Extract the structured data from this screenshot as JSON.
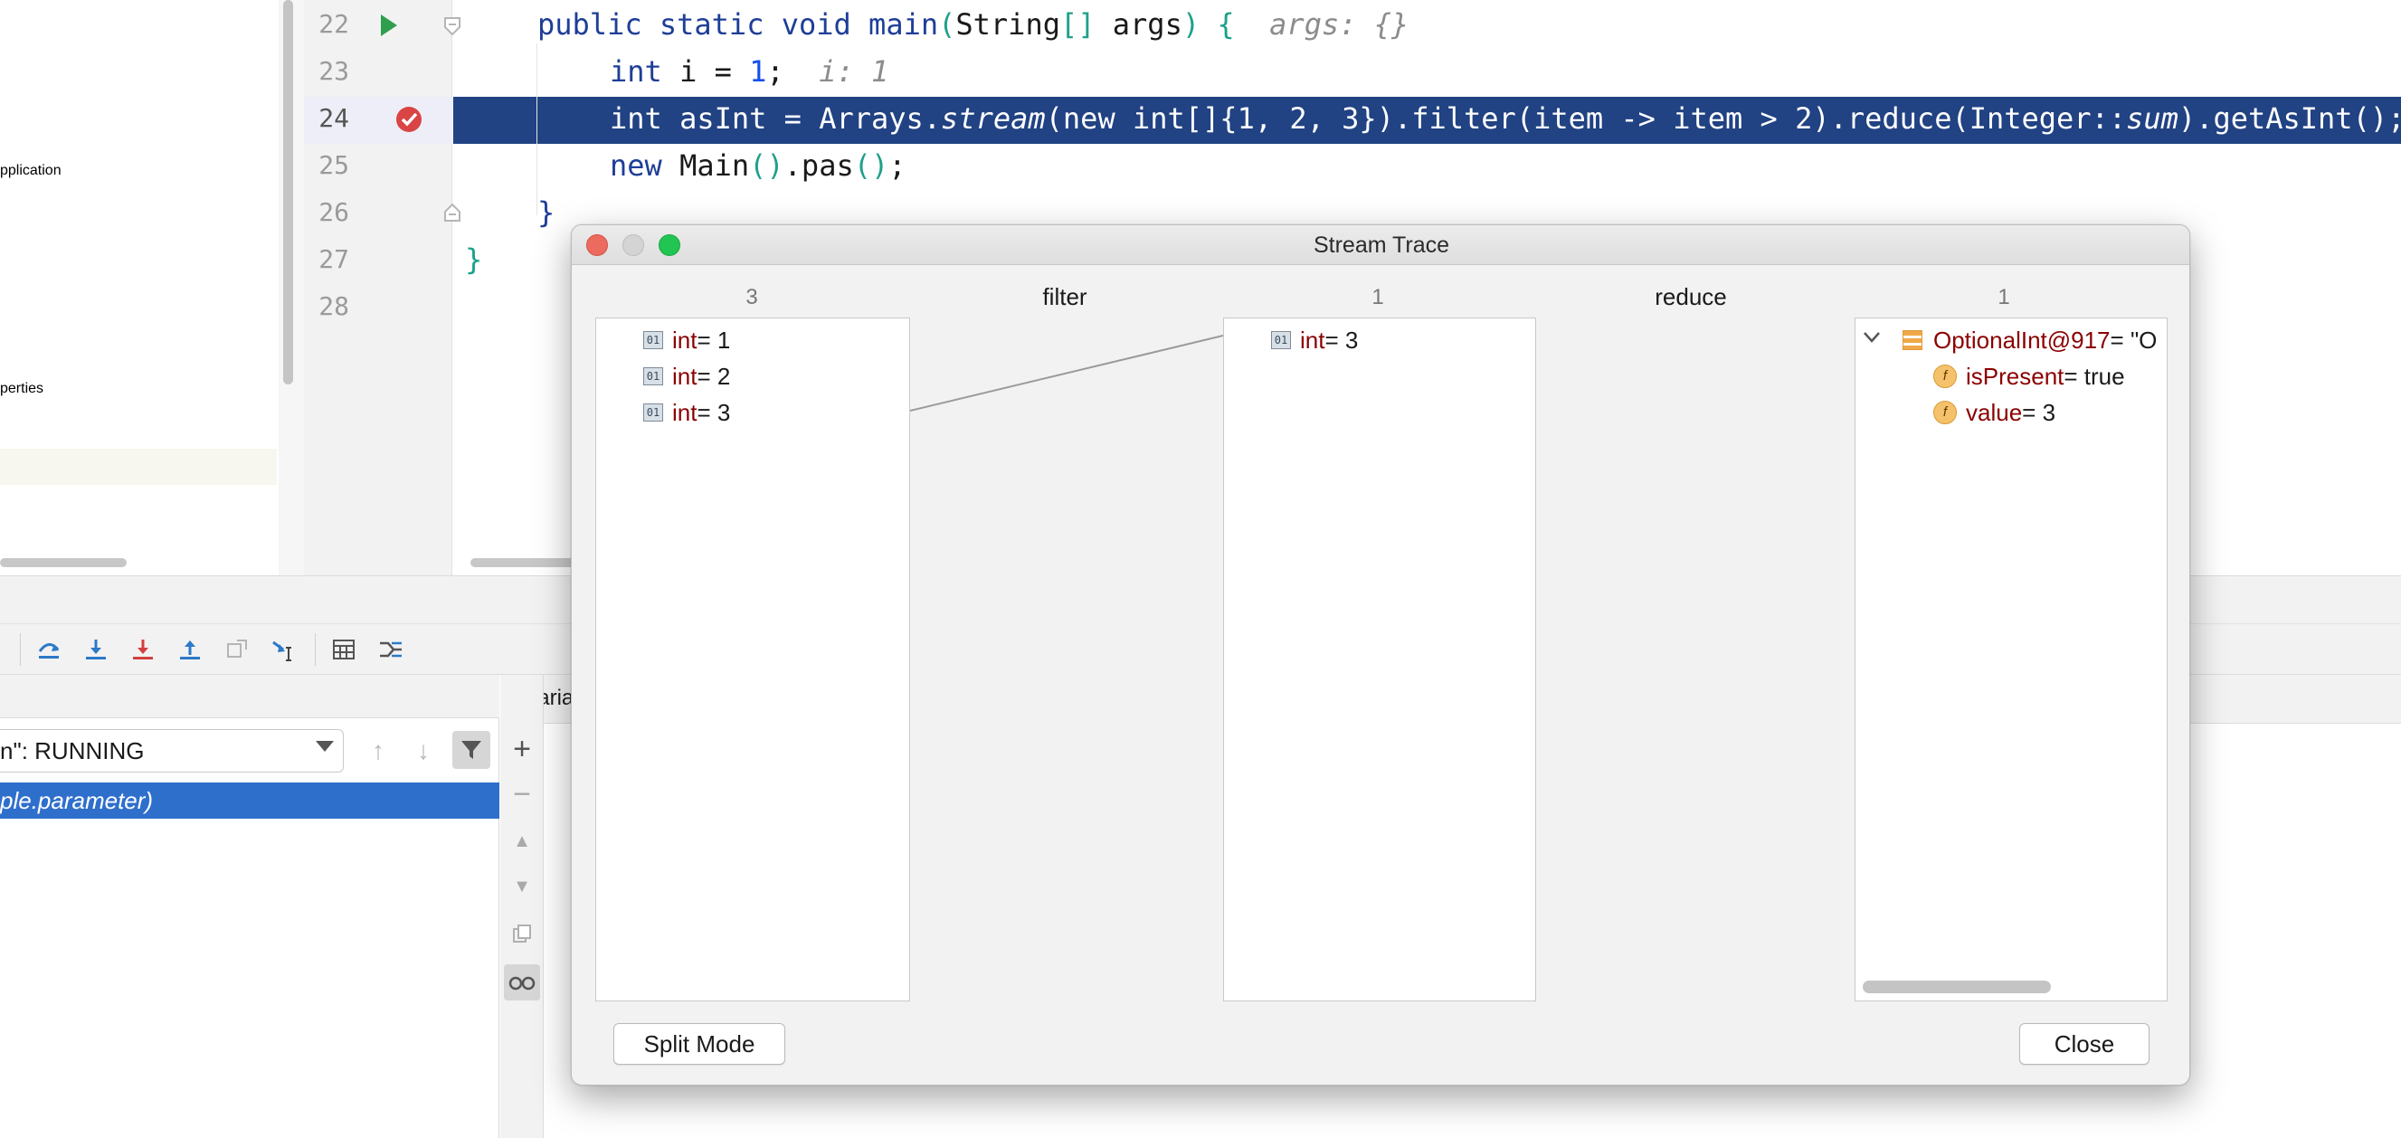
{
  "project_tree": {
    "items": [
      {
        "label": "pplication"
      },
      {
        "label": "perties"
      }
    ]
  },
  "editor": {
    "line_numbers": [
      "22",
      "23",
      "24",
      "25",
      "26",
      "27",
      "28"
    ],
    "lines": {
      "l22": {
        "kw1": "public static void ",
        "name": "main",
        "p1": "(",
        "type": "String",
        "br": "[]",
        "arg": " args",
        "p2": ")",
        "space": " ",
        "brace": "{",
        "hint": "  args: {}"
      },
      "l23": {
        "kw": "int ",
        "text": "i = ",
        "num": "1",
        "end": ";",
        "hint": "  i: 1"
      },
      "l24": {
        "a": "int asInt = Arrays.",
        "b": "stream",
        "c": "(new int[]{1, 2, 3}).filter(item -> item > 2).reduce(Integer::",
        "d": "sum",
        "e": ").getAsInt();"
      },
      "l25": {
        "kw": "new ",
        "text": "Main",
        "p": "()",
        "call": ".pas",
        "p2": "()",
        "end": ";"
      },
      "l26": {
        "brace": "}"
      },
      "l27": {
        "brace": "}"
      }
    },
    "breakpoint_line": "24",
    "current_line": "24",
    "colors": {
      "selection": "#214283",
      "keyword": "#1e3e97",
      "number": "#1750eb"
    }
  },
  "debugger": {
    "toolbar_icons": [
      "step-over-icon",
      "step-into-icon",
      "force-step-into-icon",
      "step-out-icon",
      "drop-frame-icon",
      "run-to-cursor-icon",
      "evaluate-expression-icon",
      "trace-stream-icon"
    ],
    "thread_select_value": "n\": RUNNING",
    "selected_frame": "ple.parameter)",
    "variables_tab_label": "Varia"
  },
  "stream_trace": {
    "title": "Stream Trace",
    "columns": [
      {
        "count": "3",
        "items": [
          {
            "type": "int",
            "value": " = 1"
          },
          {
            "type": "int",
            "value": " = 2"
          },
          {
            "type": "int",
            "value": " = 3"
          }
        ]
      },
      {
        "count": "1",
        "items": [
          {
            "type": "int",
            "value": " = 3"
          }
        ]
      },
      {
        "count": "1",
        "root": {
          "type": "OptionalInt@917",
          "value": " = \"O"
        },
        "fields": [
          {
            "name": "isPresent",
            "value": " = true"
          },
          {
            "name": "value",
            "value": " = 3"
          }
        ]
      }
    ],
    "operations": [
      "filter",
      "reduce"
    ],
    "badge_text": "01",
    "field_badge_text": "f",
    "split_mode_label": "Split Mode",
    "close_label": "Close"
  }
}
